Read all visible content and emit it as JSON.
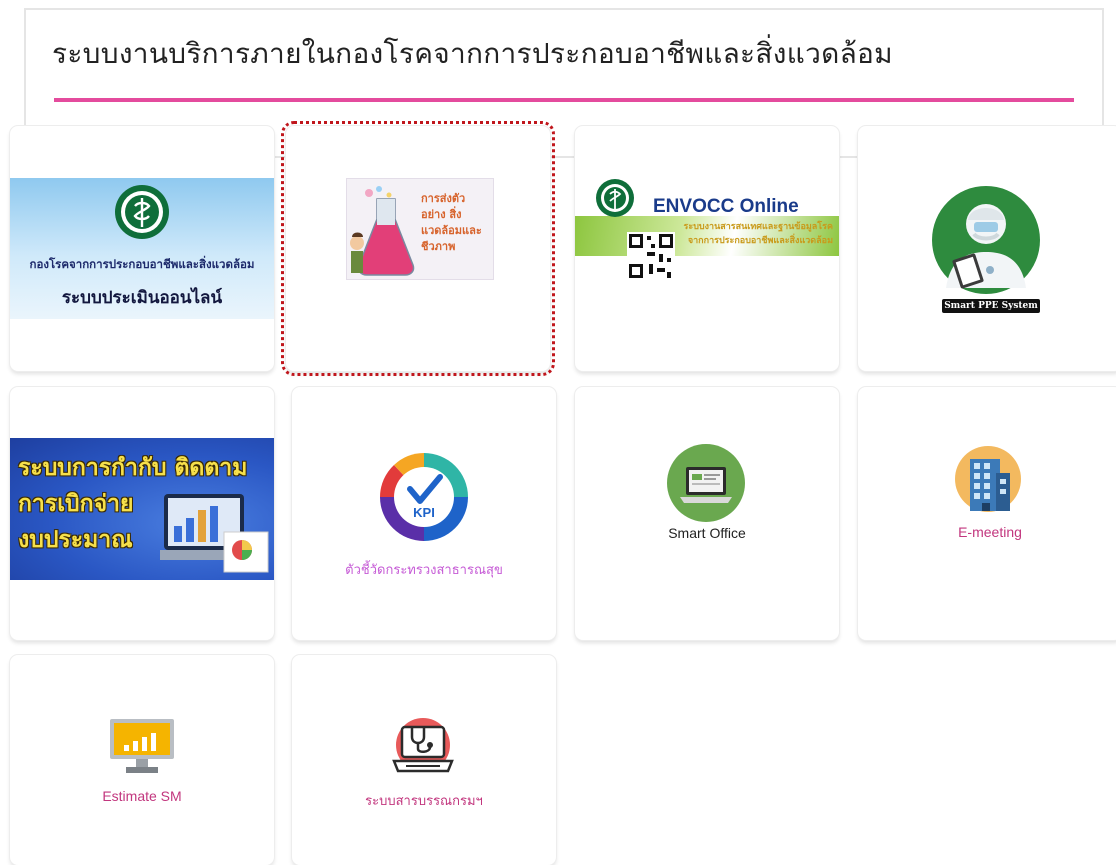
{
  "page": {
    "title": "ระบบงานบริการภายในกองโรคจากการประกอบอาชีพและสิ่งแวดล้อม",
    "accent_color": "#e44b9d"
  },
  "cards": [
    {
      "id": "online-assessment",
      "icon": "department-logo-icon",
      "banner_line1": "กองโรคจากการประกอบอาชีพและสิ่งแวดล้อม",
      "banner_line2": "ระบบประเมินออนไลน์",
      "caption": ""
    },
    {
      "id": "sample-submission",
      "icon": "lab-flask-icon",
      "selected": true,
      "banner_text": "การส่งตัวอย่าง สิ่งแวดล้อมและ ชีวภาพ",
      "caption": ""
    },
    {
      "id": "envocc-online",
      "icon": "envocc-logo-icon",
      "banner_title": "ENVOCC Online",
      "banner_sub": "ระบบงานสารสนเทศและฐานข้อมูลโรคจากการประกอบอาชีพและสิ่งแวดล้อม",
      "caption": ""
    },
    {
      "id": "smart-ppe",
      "icon": "ppe-worker-icon",
      "badge": "Smart PPE System",
      "caption": ""
    },
    {
      "id": "budget-tracking",
      "icon": "budget-report-icon",
      "banner_lines": [
        "ระบบการกำกับ ติดตาม",
        "การเบิกจ่าย",
        "งบประมาณ"
      ],
      "caption": ""
    },
    {
      "id": "kpi",
      "icon": "kpi-gauge-icon",
      "icon_label": "KPI",
      "caption": "ตัวชี้วัดกระทรวงสาธารณสุข",
      "caption_color": "#c65bd6"
    },
    {
      "id": "smart-office",
      "icon": "laptop-icon",
      "caption": "Smart Office",
      "caption_color": "#222222"
    },
    {
      "id": "e-meeting",
      "icon": "building-icon",
      "caption": "E-meeting",
      "caption_color": "#c2367e"
    },
    {
      "id": "estimate-sm",
      "icon": "monitor-chart-icon",
      "caption": "Estimate SM",
      "caption_color": "#c2367e"
    },
    {
      "id": "library",
      "icon": "stethoscope-laptop-icon",
      "caption": "ระบบสารบรรณกรมฯ",
      "caption_color": "#c2367e"
    }
  ]
}
